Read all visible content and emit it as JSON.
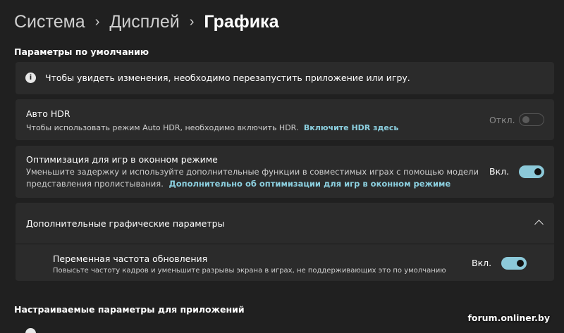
{
  "breadcrumb": {
    "items": [
      "Система",
      "Дисплей"
    ],
    "current": "Графика"
  },
  "defaults_section": {
    "title": "Параметры по умолчанию",
    "info_text": "Чтобы увидеть изменения, необходимо перезапустить приложение или игру."
  },
  "auto_hdr": {
    "title": "Авто HDR",
    "description": "Чтобы использовать режим Auto HDR, необходимо включить HDR.",
    "link": "Включите HDR здесь",
    "state_label": "Откл.",
    "enabled": false
  },
  "windowed_opt": {
    "title": "Оптимизация для игр в оконном режиме",
    "description_line1": "Уменьшите задержку и используйте дополнительные функции в совместимых играх с помощью модели",
    "description_line2": "представления пролистывания.",
    "link": "Дополнительно об оптимизации для игр в оконном режиме",
    "state_label": "Вкл.",
    "enabled": true
  },
  "advanced": {
    "title": "Дополнительные графические параметры",
    "expanded": true,
    "vrr": {
      "title": "Переменная частота обновления",
      "description": "Повысьте частоту кадров и уменьшите разрывы экрана в играх, не поддерживающих это по умолчанию",
      "state_label": "Вкл.",
      "enabled": true
    }
  },
  "custom_section": {
    "title": "Настраиваемые параметры для приложений"
  },
  "watermark": "forum.onliner.by",
  "colors": {
    "background": "#202020",
    "card": "#2b2b2b",
    "accent": "#8cc9d9",
    "link": "#8cd0e0"
  },
  "icons": {
    "info": "info-icon",
    "chevron": "chevron-up-icon"
  }
}
